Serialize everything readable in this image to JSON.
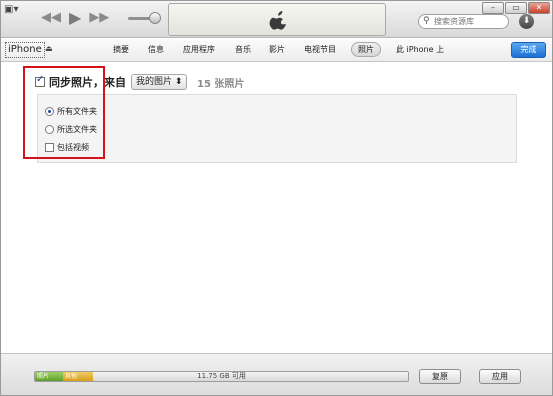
{
  "toolbar": {
    "menu_icon": "▣▾",
    "prev_icon": "◀◀",
    "play_icon": "▶",
    "next_icon": "▶▶",
    "window_minimize": "–",
    "window_maximize": "▭",
    "window_close": "✕",
    "search_placeholder": "搜索资源库",
    "download_icon": "⬇"
  },
  "navbar": {
    "device_name": "iPhone",
    "eject_icon": "⏏",
    "tabs": [
      {
        "label": "摘要"
      },
      {
        "label": "信息"
      },
      {
        "label": "应用程序"
      },
      {
        "label": "音乐"
      },
      {
        "label": "影片"
      },
      {
        "label": "电视节目"
      },
      {
        "label": "照片"
      },
      {
        "label": "此 iPhone 上"
      }
    ],
    "done_label": "完成"
  },
  "sync": {
    "checked": true,
    "label": "同步照片，来自",
    "source": "我的图片 ⬍",
    "count": "15 张照片",
    "options": {
      "all_folders": "所有文件夹",
      "selected_folders": "所选文件夹",
      "include_videos": "包括视频"
    }
  },
  "storage": {
    "photos_label": "照片",
    "other_label": "其他",
    "free_label": "11.75 GB 可用"
  },
  "buttons": {
    "revert": "复原",
    "apply": "应用"
  },
  "colors": {
    "done_blue": "#1e6fd3",
    "highlight_red": "#d3121b",
    "photos_green": "#5f9e2a",
    "other_orange": "#d79e1b"
  }
}
